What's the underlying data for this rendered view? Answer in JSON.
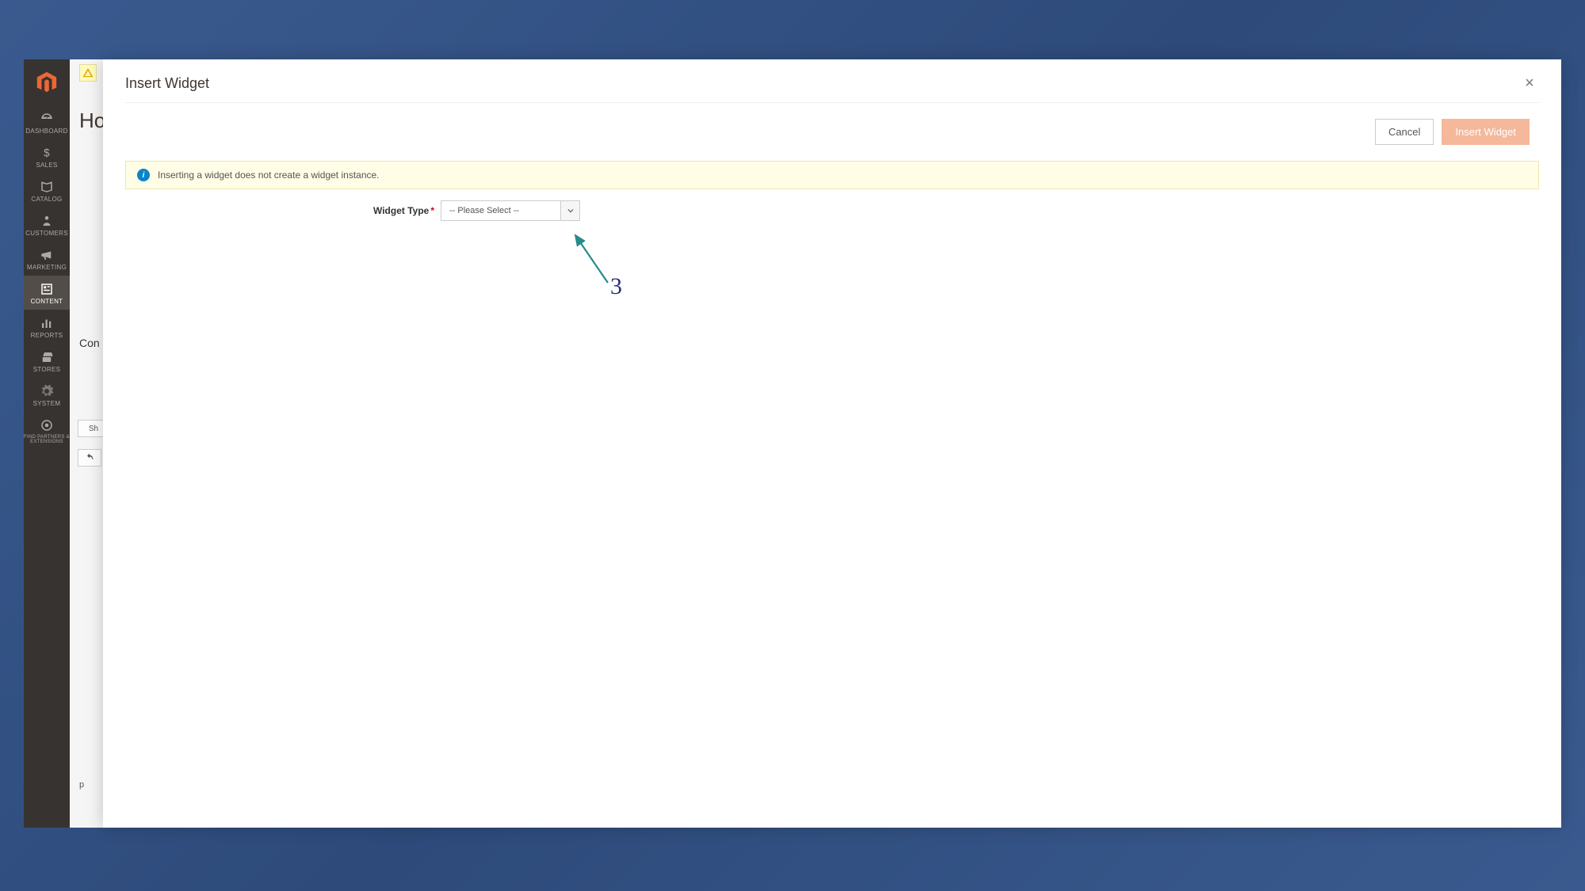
{
  "sidebar": {
    "items": [
      {
        "label": "DASHBOARD"
      },
      {
        "label": "SALES"
      },
      {
        "label": "CATALOG"
      },
      {
        "label": "CUSTOMERS"
      },
      {
        "label": "MARKETING"
      },
      {
        "label": "CONTENT"
      },
      {
        "label": "REPORTS"
      },
      {
        "label": "STORES"
      },
      {
        "label": "SYSTEM"
      },
      {
        "label": "FIND PARTNERS & EXTENSIONS"
      }
    ]
  },
  "background_page": {
    "title_fragment": "Ho",
    "section_fragment": "Con",
    "toolbar_fragment": "Sh",
    "status_fragment": "p"
  },
  "modal": {
    "title": "Insert Widget",
    "close_glyph": "×",
    "actions": {
      "cancel": "Cancel",
      "primary": "Insert Widget"
    },
    "info_message": "Inserting a widget does not create a widget instance.",
    "form": {
      "widget_type_label": "Widget Type",
      "widget_type_value": "-- Please Select --"
    }
  },
  "annotation": {
    "number": "3",
    "arrow_color": "#2a8a8a"
  }
}
